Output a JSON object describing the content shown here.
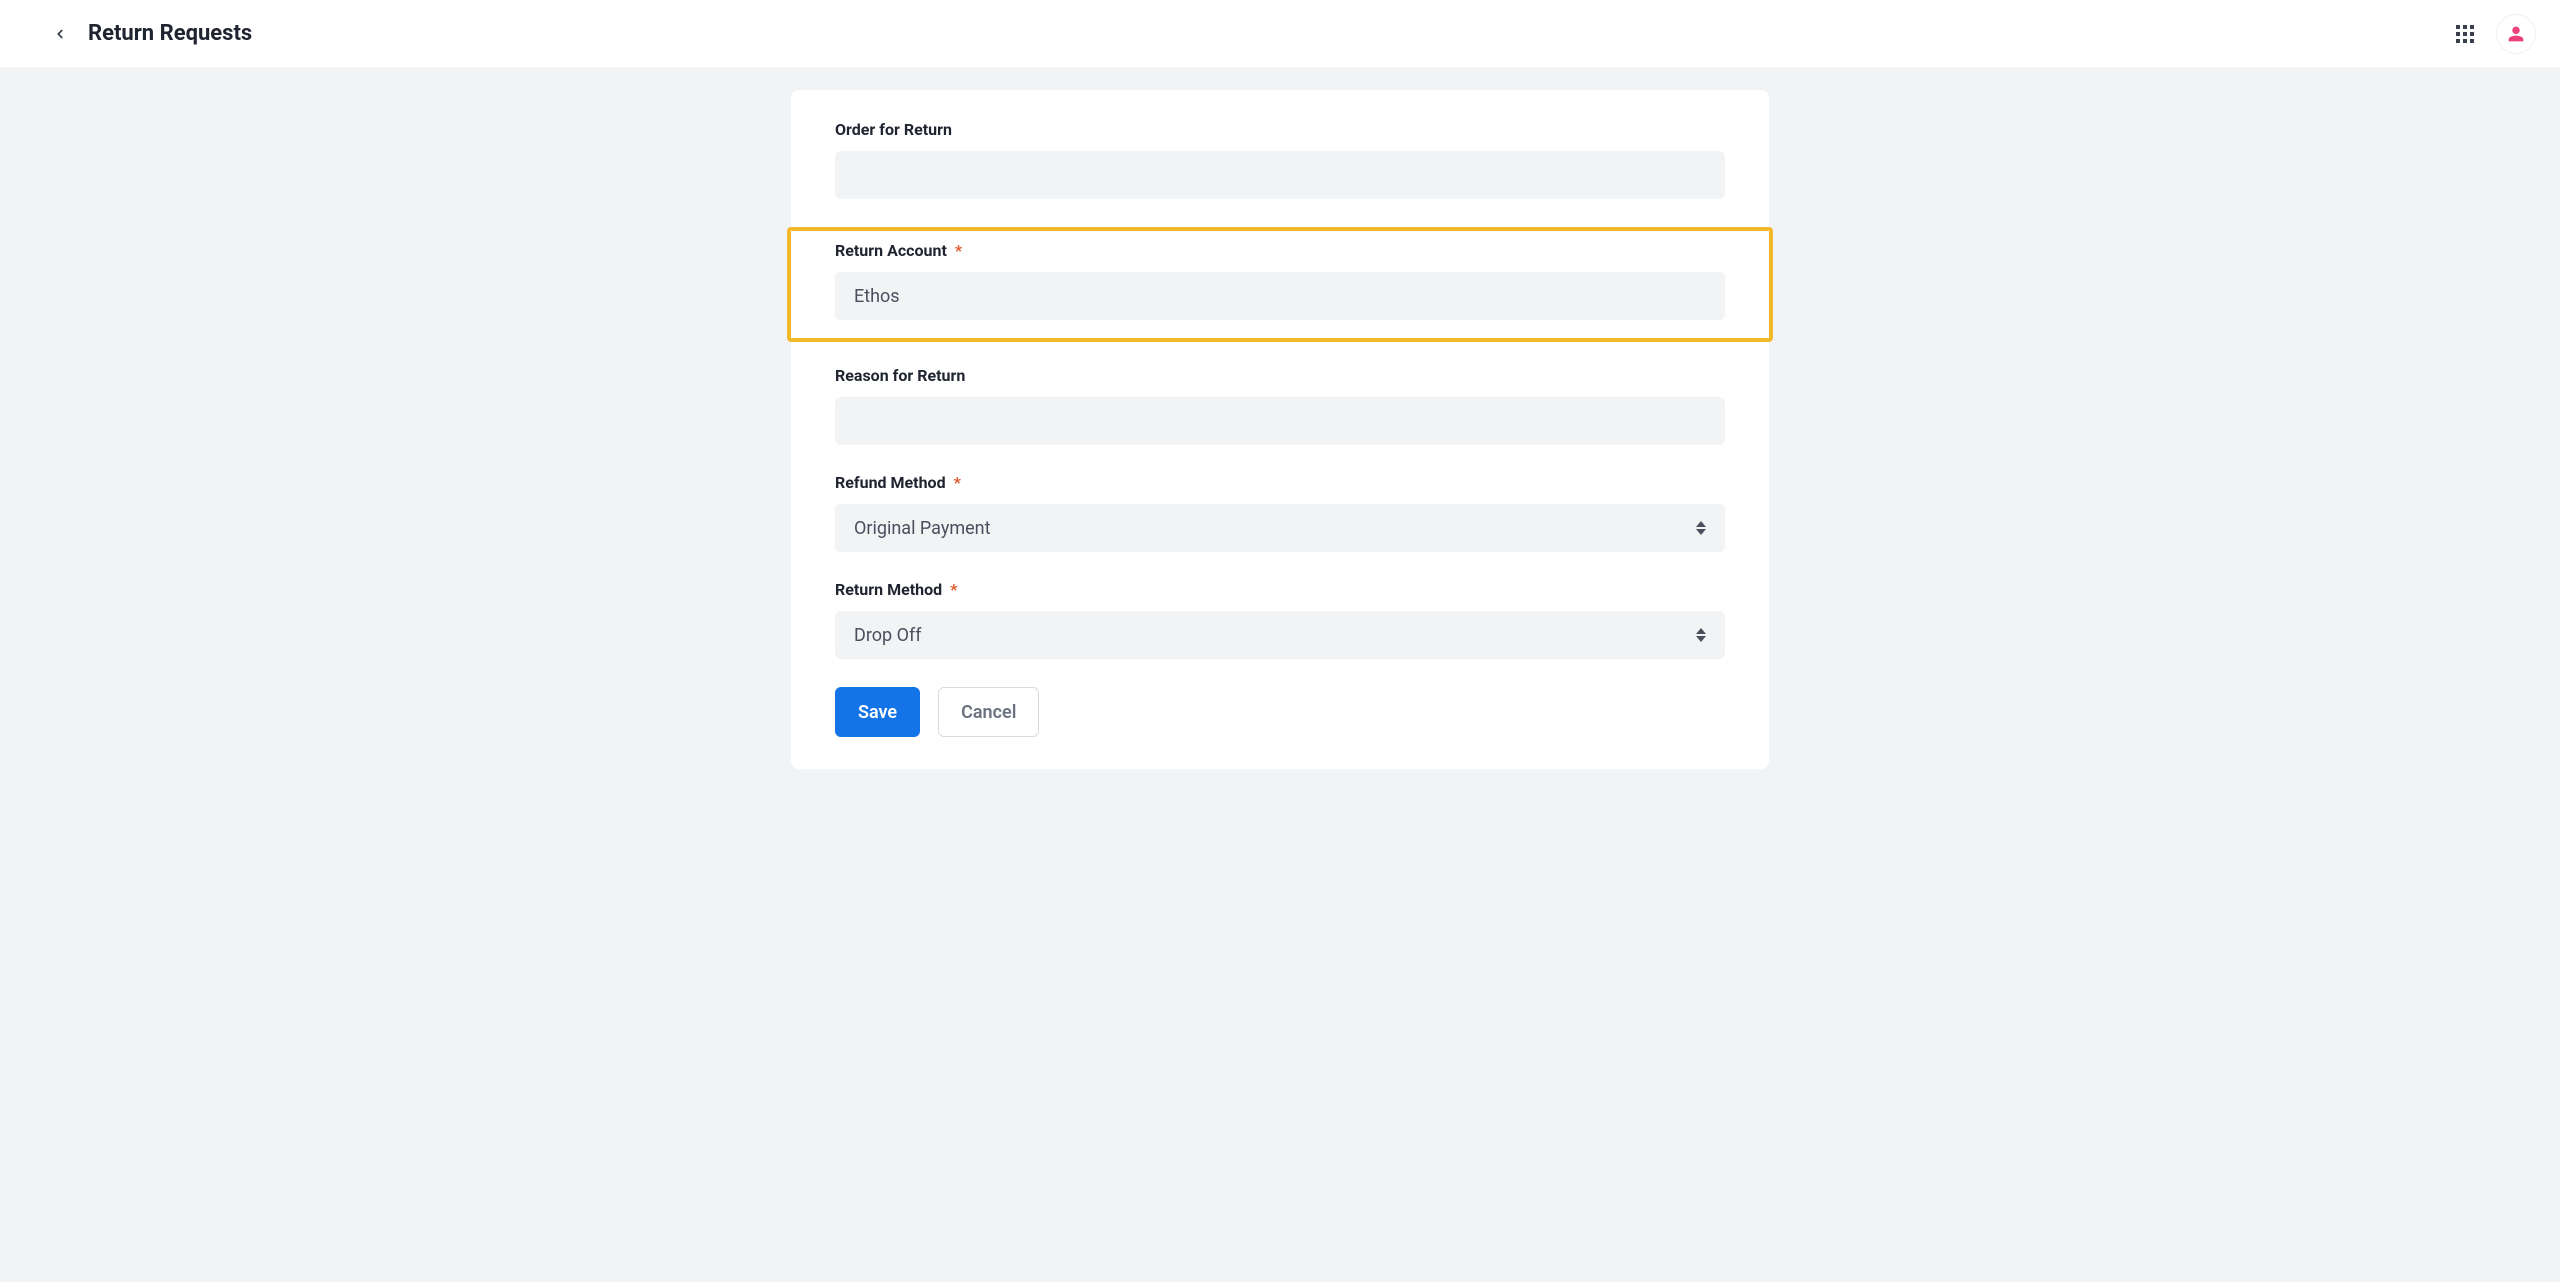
{
  "header": {
    "title": "Return Requests"
  },
  "form": {
    "order_for_return": {
      "label": "Order for Return",
      "value": "",
      "required": false
    },
    "return_account": {
      "label": "Return Account",
      "value": "Ethos",
      "required": true
    },
    "reason_for_return": {
      "label": "Reason for Return",
      "value": "",
      "required": false
    },
    "refund_method": {
      "label": "Refund Method",
      "value": "Original Payment",
      "required": true
    },
    "return_method": {
      "label": "Return Method",
      "value": "Drop Off",
      "required": true
    }
  },
  "actions": {
    "save_label": "Save",
    "cancel_label": "Cancel"
  },
  "required_mark": "*"
}
